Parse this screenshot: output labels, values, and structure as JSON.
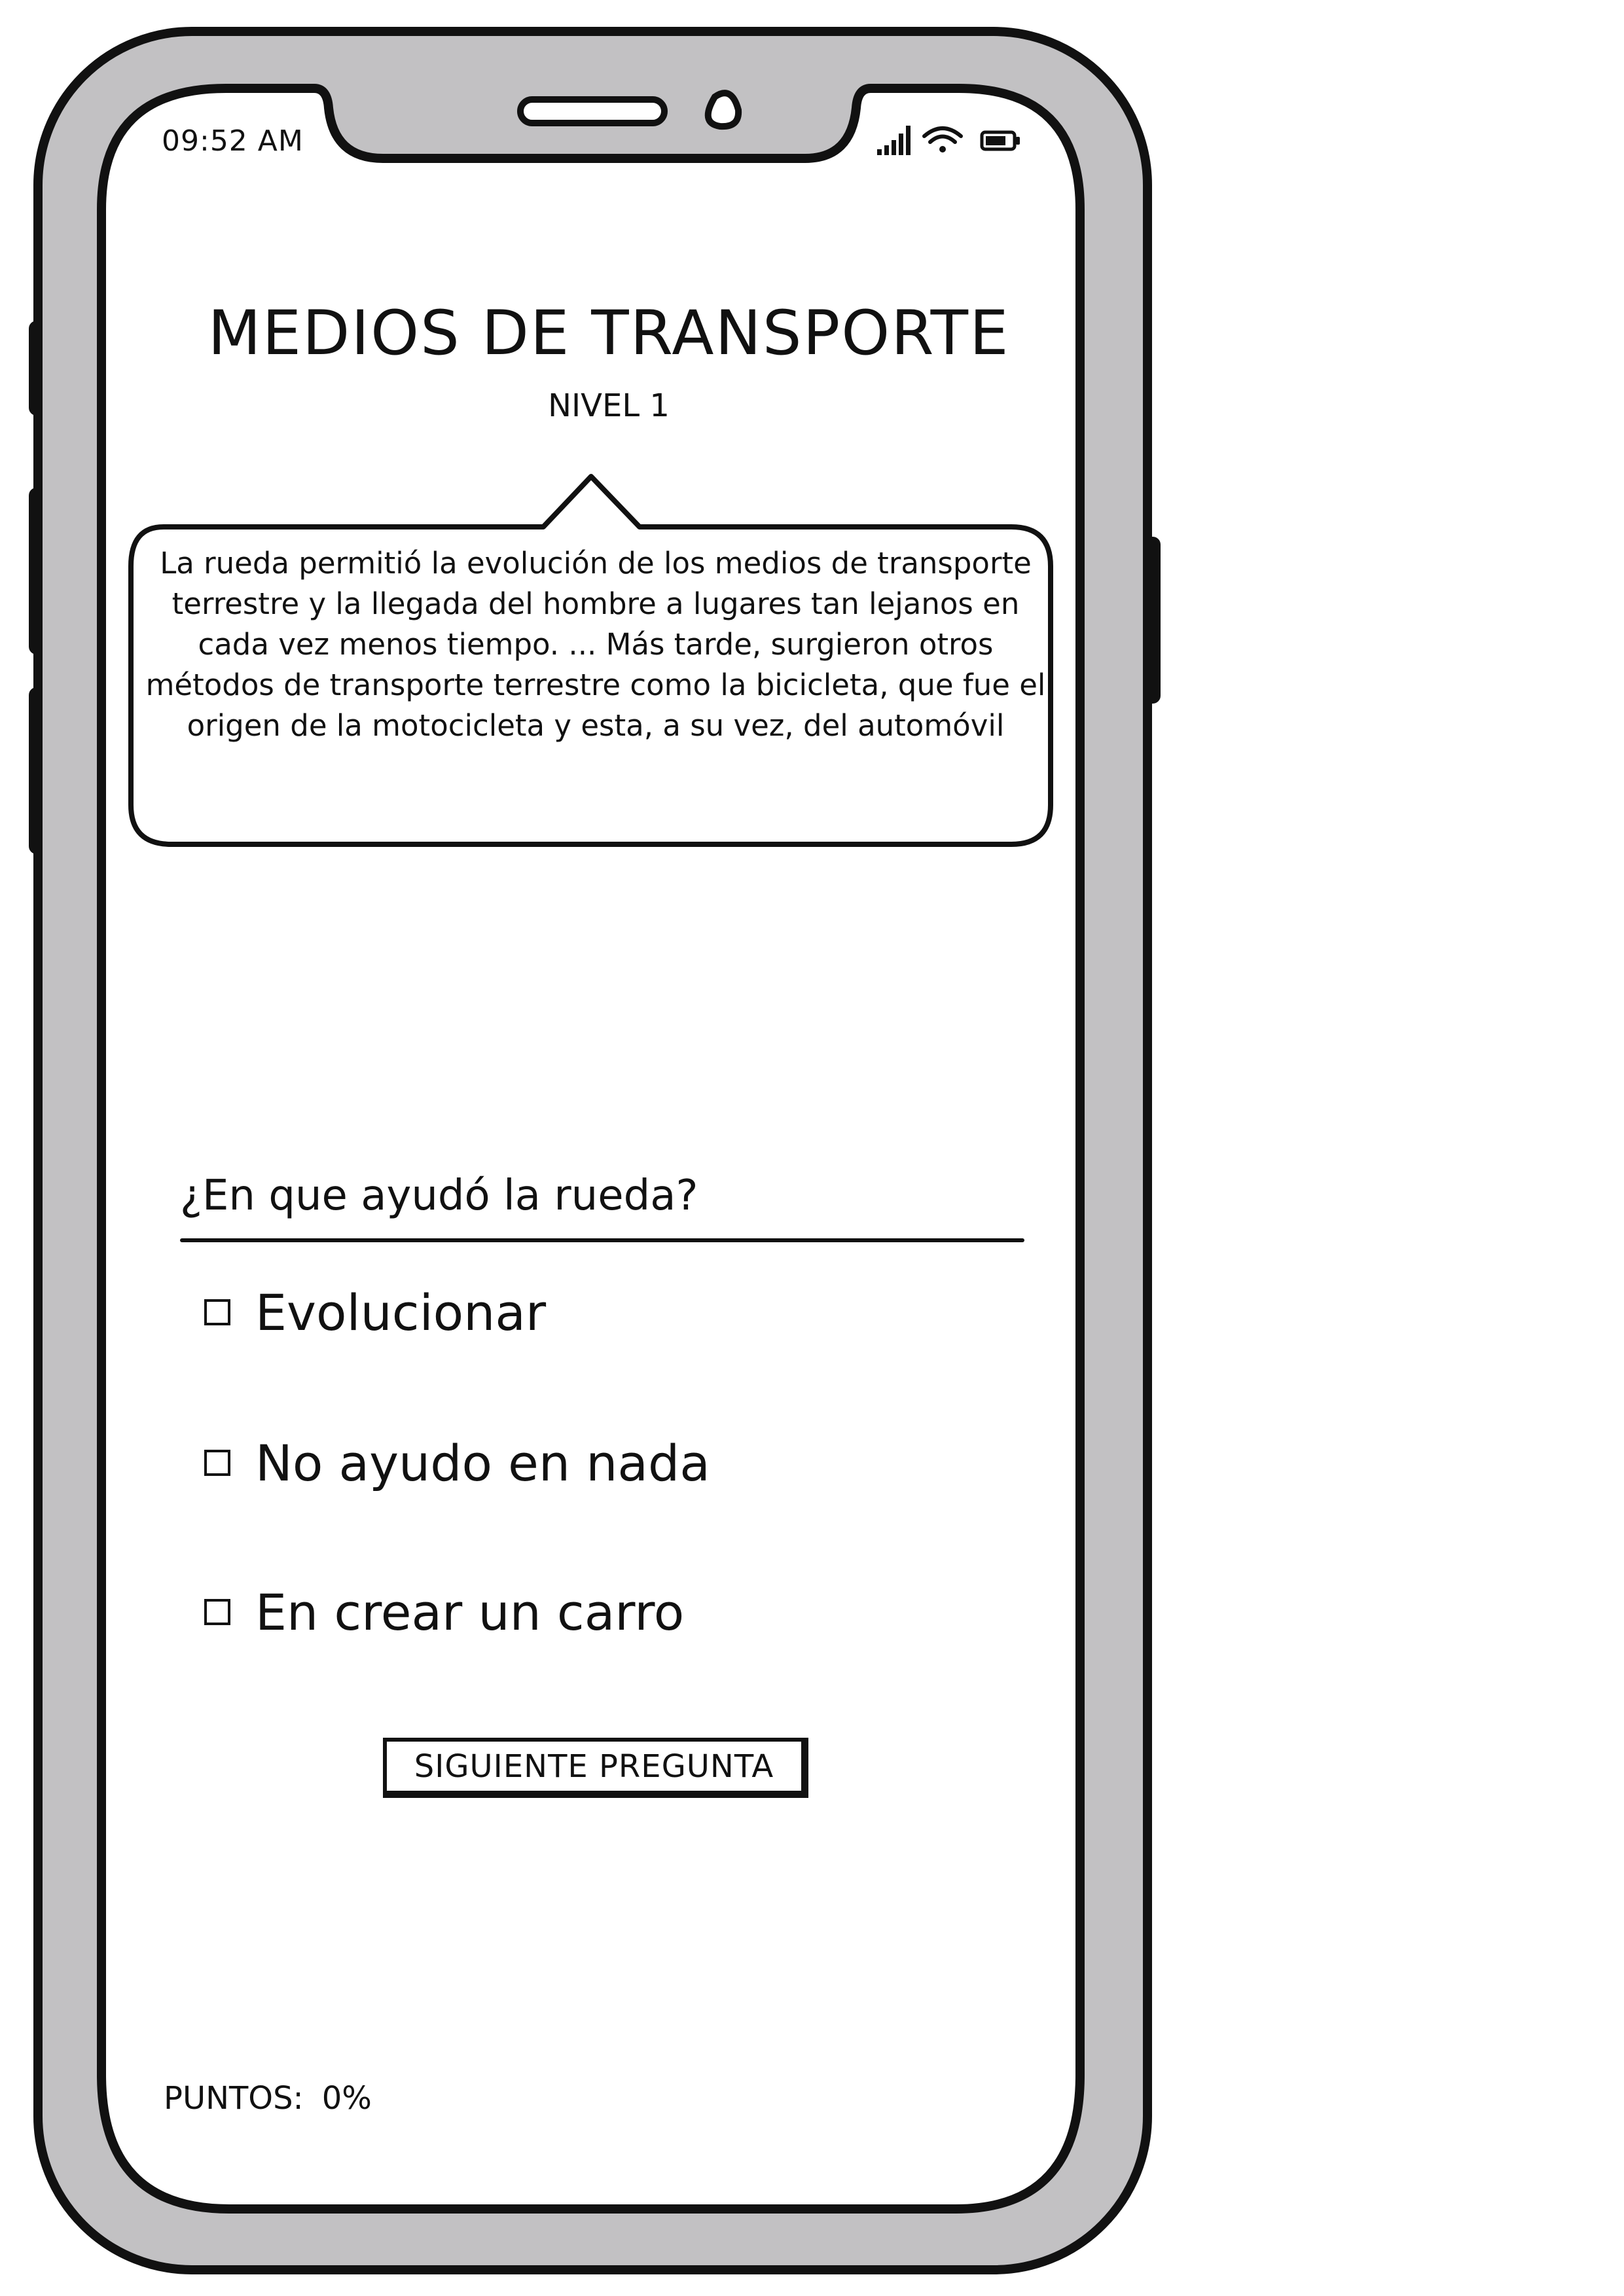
{
  "status_bar": {
    "time": "09:52 AM",
    "icons": [
      "signal-icon",
      "wifi-icon",
      "battery-icon"
    ]
  },
  "header": {
    "title": "MEDIOS DE TRANSPORTE",
    "level": "NIVEL 1"
  },
  "callout": {
    "text": "La rueda permitió la evolución de los medios de transporte terrestre y la llegada del hombre a lugares tan lejanos en cada vez menos tiempo. ... Más tarde, surgieron otros métodos de transporte terrestre como la bicicleta, que fue el origen de la motocicleta y esta, a su vez, del automóvil"
  },
  "quiz": {
    "question": "¿En que ayudó la rueda?",
    "options": [
      {
        "label": "Evolucionar",
        "checked": false
      },
      {
        "label": "No ayudo en nada",
        "checked": false
      },
      {
        "label": "En crear un carro",
        "checked": false
      }
    ],
    "next_label": "SIGUIENTE PREGUNTA"
  },
  "footer": {
    "points_label": "PUNTOS:",
    "points_value": "0%"
  },
  "colors": {
    "phone_body": "#c2c1c3",
    "outline": "#111111",
    "screen": "#ffffff"
  }
}
